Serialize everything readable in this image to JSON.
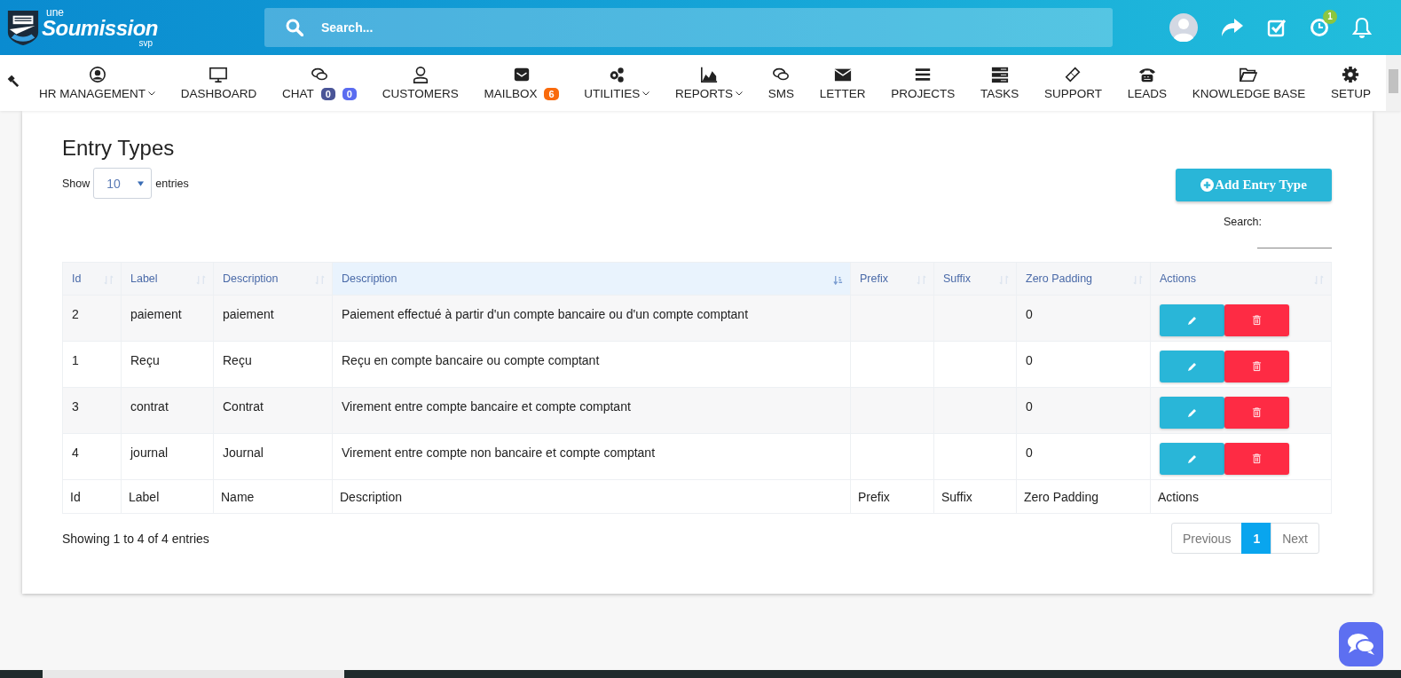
{
  "header": {
    "logo": {
      "top": "une",
      "main": "Soumission",
      "bottom": "svp"
    },
    "search": {
      "placeholder": "Search..."
    },
    "notification_badge": "1"
  },
  "nav": [
    {
      "label": "HR MANAGEMENT",
      "dropdown": true
    },
    {
      "label": "DASHBOARD",
      "dropdown": false
    },
    {
      "label": "CHAT",
      "dropdown": false,
      "badges": [
        {
          "text": "0",
          "color": "#4a5597"
        },
        {
          "text": "0",
          "color": "#5a6cf0"
        }
      ]
    },
    {
      "label": "CUSTOMERS",
      "dropdown": false
    },
    {
      "label": "MAILBOX",
      "dropdown": false,
      "badges": [
        {
          "text": "6",
          "color": "#f96a0c"
        }
      ]
    },
    {
      "label": "UTILITIES",
      "dropdown": true
    },
    {
      "label": "REPORTS",
      "dropdown": true
    },
    {
      "label": "SMS",
      "dropdown": false
    },
    {
      "label": "LETTER",
      "dropdown": false
    },
    {
      "label": "PROJECTS",
      "dropdown": false
    },
    {
      "label": "TASKS",
      "dropdown": false
    },
    {
      "label": "SUPPORT",
      "dropdown": false
    },
    {
      "label": "LEADS",
      "dropdown": false
    },
    {
      "label": "KNOWLEDGE BASE",
      "dropdown": false
    },
    {
      "label": "SETUP",
      "dropdown": false
    }
  ],
  "page": {
    "title": "Entry Types",
    "length": {
      "label_before": "Show",
      "value": "10",
      "label_after": "entries"
    },
    "add_button": "Add Entry Type",
    "search_label": "Search:"
  },
  "table": {
    "columns": [
      {
        "label": "Id",
        "sorted": false
      },
      {
        "label": "Label",
        "sorted": false
      },
      {
        "label": "Description",
        "sorted": false
      },
      {
        "label": "Description",
        "sorted": true
      },
      {
        "label": "Prefix",
        "sorted": false
      },
      {
        "label": "Suffix",
        "sorted": false
      },
      {
        "label": "Zero Padding",
        "sorted": false
      },
      {
        "label": "Actions",
        "sorted": false
      }
    ],
    "rows": [
      [
        "2",
        "paiement",
        "paiement",
        "Paiement effectué à partir d'un compte bancaire ou d'un compte comptant",
        "",
        "",
        "0"
      ],
      [
        "1",
        "Reçu",
        "Reçu",
        "Reçu en compte bancaire ou compte comptant",
        "",
        "",
        "0"
      ],
      [
        "3",
        "contrat",
        "Contrat",
        "Virement entre compte bancaire et compte comptant",
        "",
        "",
        "0"
      ],
      [
        "4",
        "journal",
        "Journal",
        "Virement entre compte non bancaire et compte comptant",
        "",
        "",
        "0"
      ]
    ],
    "footer": [
      "Id",
      "Label",
      "Name",
      "Description",
      "Prefix",
      "Suffix",
      "Zero Padding",
      "Actions"
    ]
  },
  "info": "Showing 1 to 4 of 4 entries",
  "pagination": [
    {
      "label": "Previous",
      "selected": false
    },
    {
      "label": "1",
      "selected": true
    },
    {
      "label": "Next",
      "selected": false
    }
  ]
}
